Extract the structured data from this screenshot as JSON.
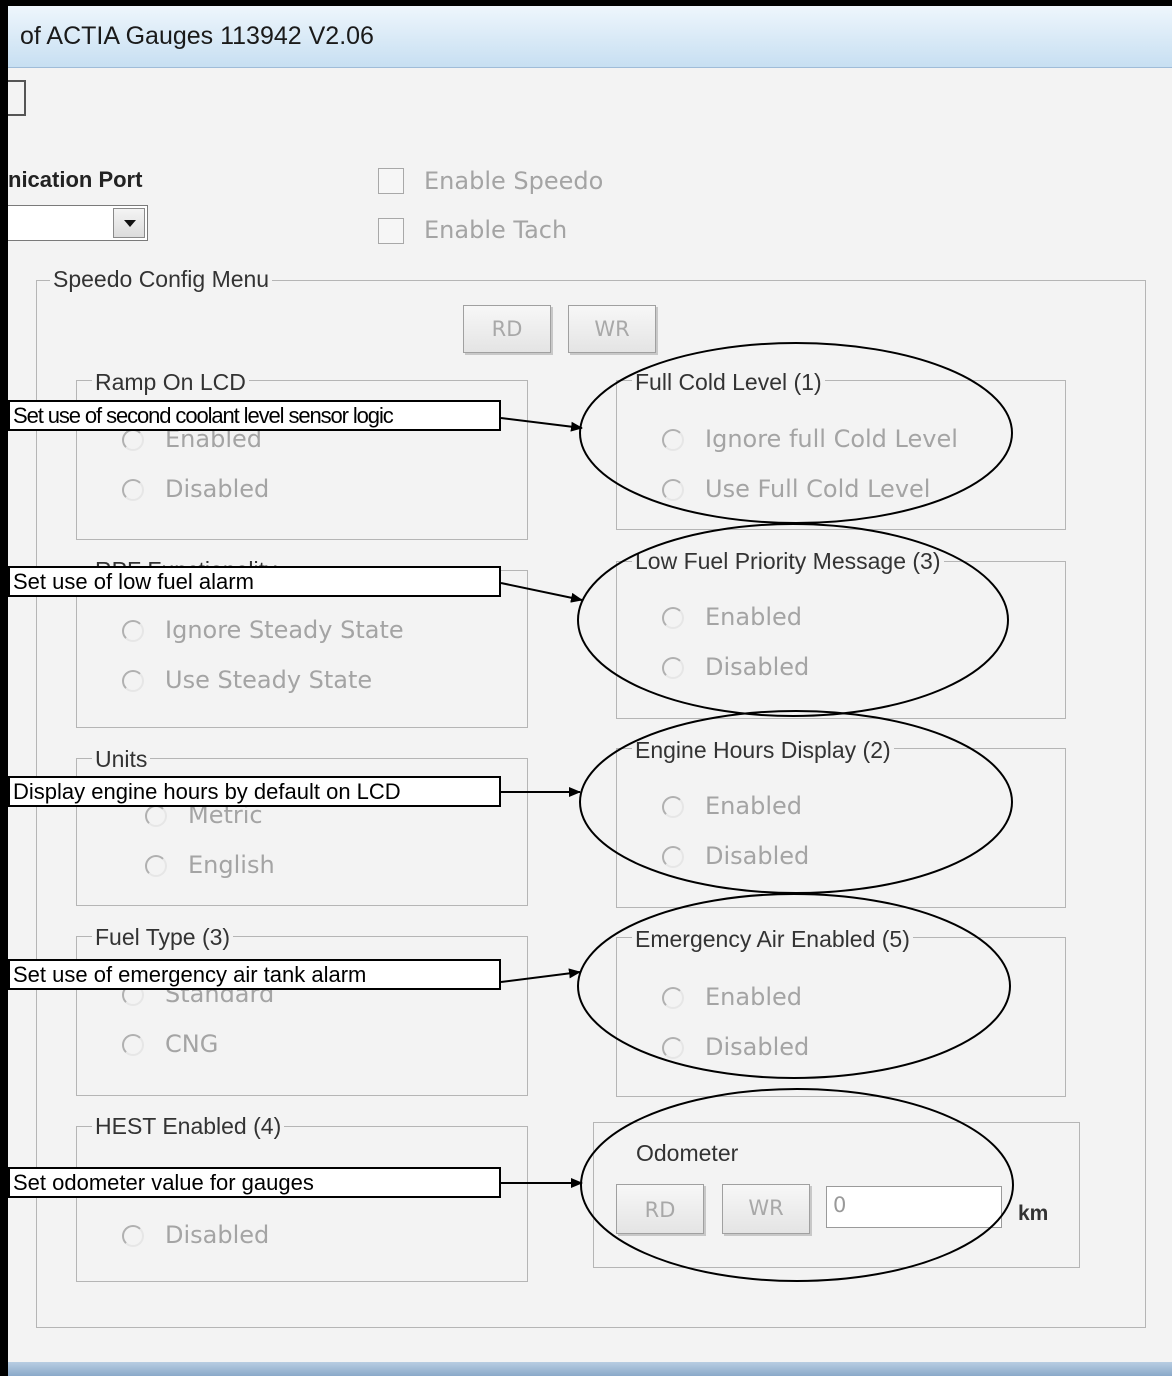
{
  "window": {
    "title": "of ACTIA Gauges 113942 V2.06"
  },
  "comm": {
    "port_label": "nication Port",
    "port_value": ""
  },
  "enable": {
    "speedo": "Enable Speedo",
    "tach": "Enable Tach"
  },
  "speedo_menu": {
    "title": "Speedo Config Menu",
    "rd_label": "RD",
    "wr_label": "WR"
  },
  "groups": {
    "ramp_on_lcd": {
      "title": "Ramp On LCD",
      "opt1": "Enabled",
      "opt2": "Disabled"
    },
    "rpf": {
      "title": "RPF Functionality",
      "opt1": "Ignore Steady State",
      "opt2": "Use Steady State"
    },
    "units": {
      "title": "Units",
      "opt1": "Metric",
      "opt2": "English"
    },
    "fuel_type": {
      "title": "Fuel Type (3)",
      "opt1": "Standard",
      "opt2": "CNG"
    },
    "hest": {
      "title": "HEST Enabled (4)",
      "opt2": "Disabled"
    },
    "full_cold": {
      "title": "Full Cold Level  (1)",
      "opt1": "Ignore full Cold Level",
      "opt2": "Use Full Cold Level"
    },
    "low_fuel": {
      "title": "Low Fuel Priority Message  (3)",
      "opt1": "Enabled",
      "opt2": "Disabled"
    },
    "engine_hours": {
      "title": "Engine Hours Display (2)",
      "opt1": "Enabled",
      "opt2": "Disabled"
    },
    "emergency_air": {
      "title": "Emergency Air Enabled (5)",
      "opt1": "Enabled",
      "opt2": "Disabled"
    },
    "odometer": {
      "title": "Odometer",
      "rd_label": "RD",
      "wr_label": "WR",
      "value": "0",
      "unit": "km"
    }
  },
  "annotations": {
    "coolant": "Set use of second coolant level sensor logic",
    "low_fuel": "Set use of low fuel alarm",
    "engine_hours": "Display engine hours by default on LCD",
    "emergency_air": "Set use of emergency air tank alarm",
    "odometer": "Set odometer value for gauges"
  },
  "colors": {
    "titlebar_top": "#eef6fc",
    "titlebar_bottom": "#c7dff2",
    "disabled_text": "#a4a4a4",
    "dialog_bg": "#f3f3f3"
  }
}
